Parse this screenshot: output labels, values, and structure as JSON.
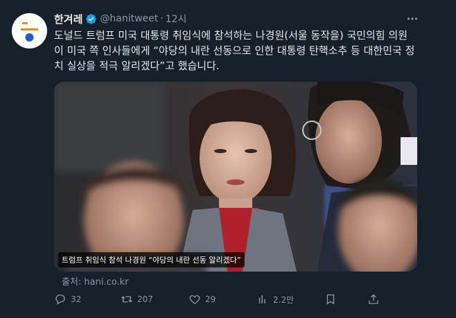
{
  "author": {
    "display_name": "한겨레",
    "handle": "@hanitweet",
    "separator": "·",
    "time": "12시"
  },
  "tweet": {
    "lines": [
      "도널드 트럼프 미국 대통령 취임식에 참석하는 나경원(서울 동작을) 국민의힘 의원",
      "이 미국 쪽 인사들에게 “야당의 내란 선동으로 인한 대통령 탄핵소추 등 대한민국 정",
      "치 실상을 적극 알리겠다”고 했습니다."
    ]
  },
  "media": {
    "caption": "트럼프 취임식 참석 나경원 “야당의 내란 선동 알리겠다”"
  },
  "source": "출처: hani.co.kr",
  "actions": {
    "replies": "32",
    "retweets": "207",
    "likes": "29",
    "views": "2.2만"
  },
  "colors": {
    "background": "#15202b",
    "text": "#e7e9ea",
    "muted": "#8b98a5",
    "verified": "#1d9bf0",
    "logo_orange": "#f08c00",
    "logo_blue": "#1e5bd1"
  },
  "icons": [
    "verified-badge-icon",
    "more-icon",
    "reply-icon",
    "retweet-icon",
    "like-icon",
    "views-icon",
    "bookmark-icon",
    "share-icon"
  ]
}
